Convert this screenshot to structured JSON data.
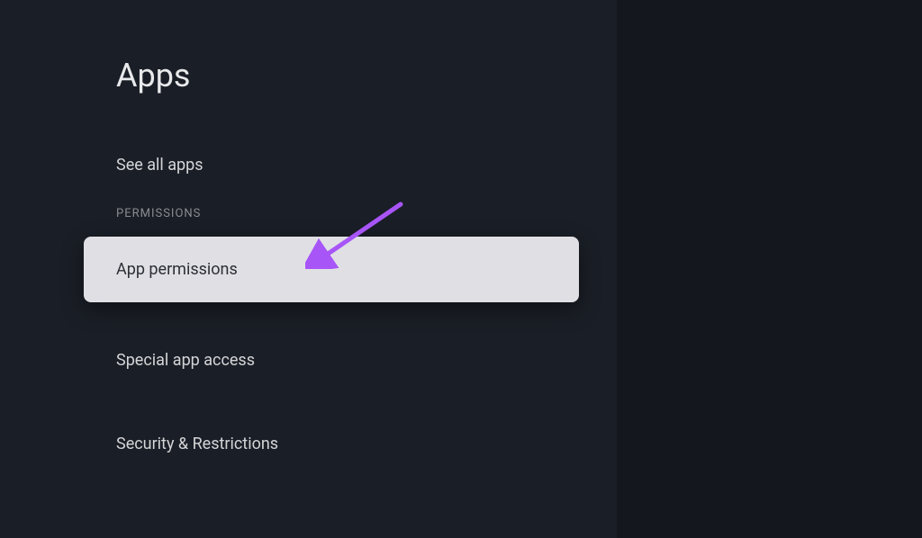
{
  "page": {
    "title": "Apps"
  },
  "items": {
    "see_all": "See all apps",
    "app_permissions": "App permissions",
    "special_access": "Special app access",
    "security": "Security & Restrictions"
  },
  "sections": {
    "permissions_header": "PERMISSIONS"
  },
  "annotation": {
    "color": "#a855f7"
  }
}
